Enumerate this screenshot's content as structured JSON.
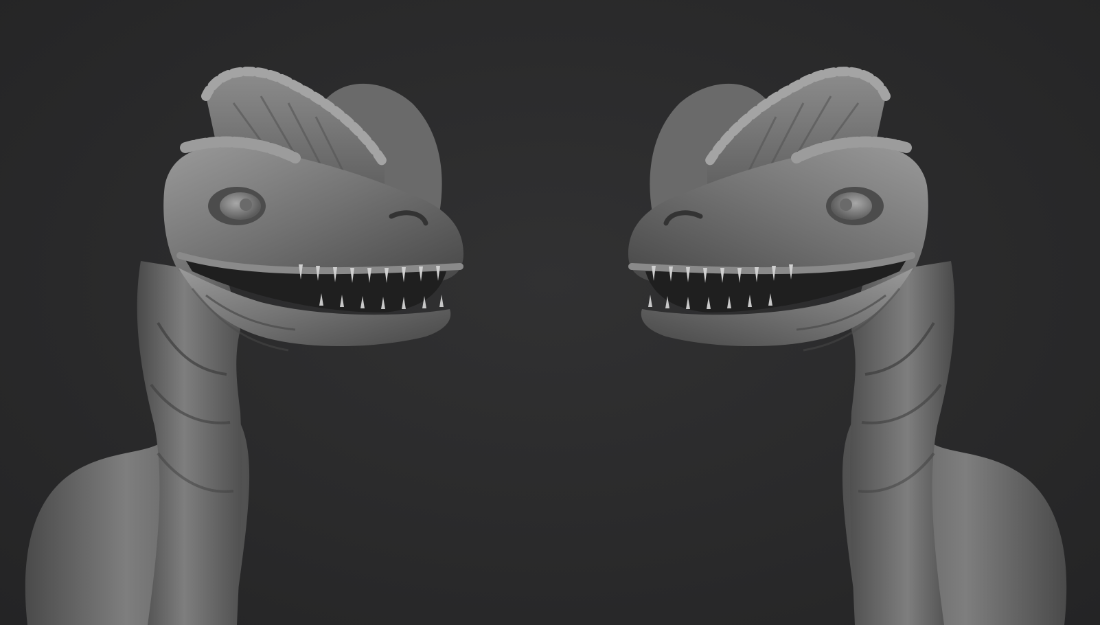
{
  "scene": {
    "subject": "",
    "colors": {
      "background": "#2a2a2b",
      "clay_base": "#6e6e6e",
      "clay_light": "#9a9a9a",
      "clay_shadow": "#3a3a3a",
      "teeth": "#d0d0d0",
      "mouth_interior": "#202020"
    },
    "views": [
      {
        "id": "left",
        "facing": "right"
      },
      {
        "id": "right",
        "facing": "left"
      }
    ]
  }
}
